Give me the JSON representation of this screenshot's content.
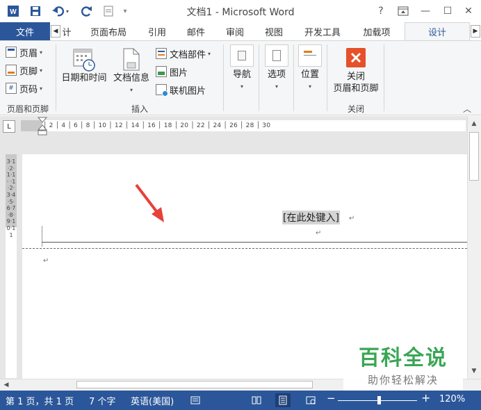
{
  "window": {
    "title": "文档1 - Microsoft Word",
    "help": "?",
    "controls": {
      "restore_ribbon": "⧉",
      "minimize": "—",
      "maximize": "☐",
      "close": "✕"
    }
  },
  "qat": {
    "app_icon": "W",
    "save_icon": "save-icon",
    "undo_icon": "undo-icon",
    "redo_icon": "redo-icon",
    "customize": "▾"
  },
  "tabs": {
    "file": "文件",
    "items": [
      "计",
      "页面布局",
      "引用",
      "邮件",
      "审阅",
      "视图",
      "开发工具",
      "加载项",
      "设计"
    ],
    "scroll_left": "◀",
    "scroll_right": "▶"
  },
  "ribbon": {
    "header_footer": {
      "items": [
        "页眉",
        "页脚",
        "页码"
      ],
      "group_label": "页眉和页脚"
    },
    "insert": {
      "date_time": "日期和时间",
      "doc_info": "文档信息",
      "doc_parts": "文档部件",
      "pictures": "图片",
      "online_pictures": "联机图片",
      "group_label": "插入"
    },
    "navigation": {
      "label": "导航"
    },
    "options": {
      "label": "选项"
    },
    "position": {
      "label": "位置"
    },
    "close": {
      "line1": "关闭",
      "line2": "页眉和页脚",
      "group_label": "关闭"
    },
    "collapse": "︿"
  },
  "ruler": {
    "tab_selector": "L",
    "h_ticks": "│ 2 │ 4 │ 6 │ 8 │ 10 │ 12 │ 14 │ 16 │ 18 │ 20 │ 22 │ 24 │ 26 │ 28 │ 30",
    "v_ticks": "3·1·2·1·1· ·1·2·3·4·5·6·7·8·9·10·11"
  },
  "document": {
    "placeholder": "[在此处键入]",
    "para_mark": "↵"
  },
  "scrollbars": {
    "up": "▲",
    "down": "▼",
    "left": "◀"
  },
  "watermark": {
    "title": "百科全说",
    "subtitle": "助你轻松解决"
  },
  "status": {
    "page": "第 1 页，共 1 页",
    "words": "7 个字",
    "language": "英语(美国)",
    "zoom_minus": "−",
    "zoom_plus": "+",
    "zoom": "120%"
  },
  "colors": {
    "accent": "#2b579a",
    "arrow": "#e8403a",
    "watermark_green": "#3aa655"
  }
}
